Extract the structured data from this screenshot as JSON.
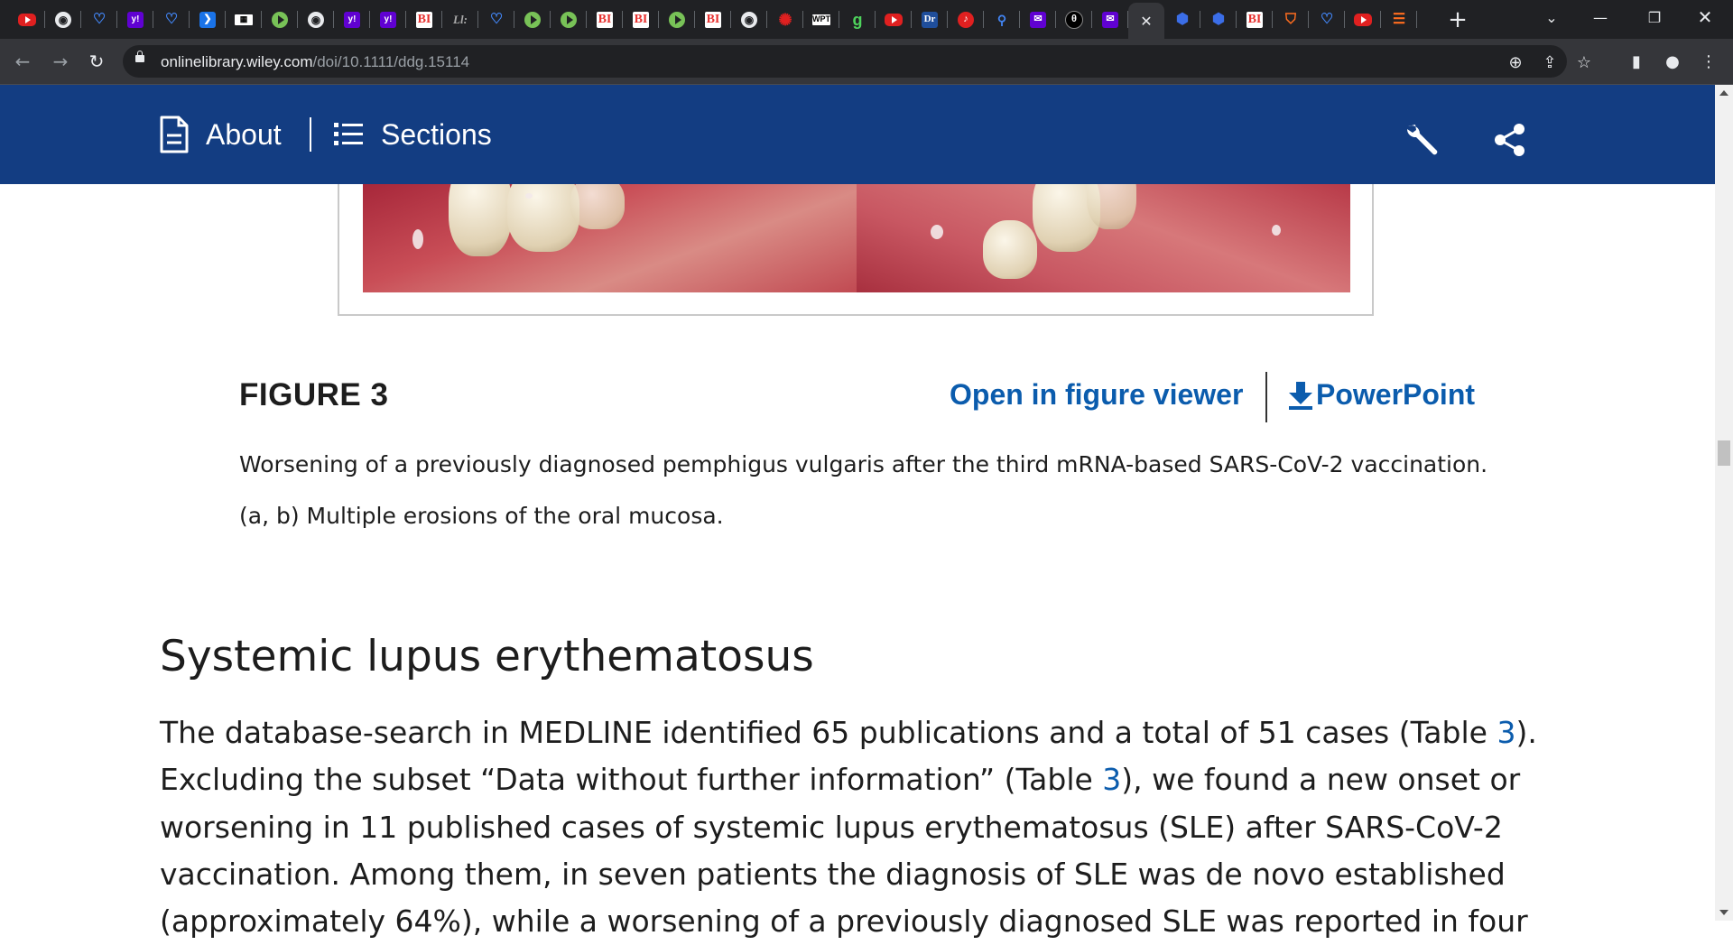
{
  "browser": {
    "tabs": [
      {
        "icon": "youtube-icon",
        "kind": "yt",
        "glyph": ""
      },
      {
        "icon": "globe-icon",
        "kind": "globe",
        "glyph": "◉"
      },
      {
        "icon": "shield-icon",
        "kind": "shield",
        "glyph": "♡"
      },
      {
        "icon": "yahoo-icon",
        "kind": "yahoo",
        "glyph": "y!"
      },
      {
        "icon": "shield-icon",
        "kind": "shield",
        "glyph": "♡"
      },
      {
        "icon": "arrow-tag-icon",
        "kind": "blue",
        "glyph": "❯"
      },
      {
        "icon": "qr-icon",
        "kind": "wpt",
        "glyph": "▦"
      },
      {
        "icon": "play-icon",
        "kind": "play",
        "glyph": ""
      },
      {
        "icon": "globe-icon",
        "kind": "globe",
        "glyph": "◉"
      },
      {
        "icon": "yahoo-icon",
        "kind": "yahoo",
        "glyph": "y!"
      },
      {
        "icon": "yahoo-icon",
        "kind": "yahoo",
        "glyph": "y!"
      },
      {
        "icon": "business-insider-icon",
        "kind": "bi",
        "glyph": "BI"
      },
      {
        "icon": "ii-icon",
        "kind": "ii",
        "glyph": "Ll:"
      },
      {
        "icon": "shield-icon",
        "kind": "shield",
        "glyph": "♡"
      },
      {
        "icon": "play-icon",
        "kind": "play",
        "glyph": ""
      },
      {
        "icon": "play-icon",
        "kind": "play",
        "glyph": ""
      },
      {
        "icon": "business-insider-icon",
        "kind": "bi",
        "glyph": "BI"
      },
      {
        "icon": "business-insider-icon",
        "kind": "bi",
        "glyph": "BI"
      },
      {
        "icon": "play-icon",
        "kind": "play",
        "glyph": ""
      },
      {
        "icon": "business-insider-icon",
        "kind": "bi",
        "glyph": "BI"
      },
      {
        "icon": "globe-icon",
        "kind": "globe",
        "glyph": "◉"
      },
      {
        "icon": "starburst-icon",
        "kind": "starb",
        "glyph": "✺"
      },
      {
        "icon": "wpt-icon",
        "kind": "wpt",
        "glyph": "WPT"
      },
      {
        "icon": "g-icon",
        "kind": "green",
        "glyph": "g"
      },
      {
        "icon": "youtube-icon",
        "kind": "yt",
        "glyph": ""
      },
      {
        "icon": "dr-icon",
        "kind": "dr",
        "glyph": "Dr"
      },
      {
        "icon": "podcast-icon",
        "kind": "red",
        "glyph": "♪"
      },
      {
        "icon": "search-icon",
        "kind": "mag",
        "glyph": "⚲"
      },
      {
        "icon": "mail-icon",
        "kind": "purple",
        "glyph": "✉"
      },
      {
        "icon": "theta-icon",
        "kind": "dark",
        "glyph": "θ"
      },
      {
        "icon": "mail-icon",
        "kind": "purple",
        "glyph": "✉"
      },
      {
        "icon": "close-icon",
        "kind": "active",
        "glyph": "✕"
      },
      {
        "icon": "hexagon-icon",
        "kind": "hex",
        "glyph": "⬢"
      },
      {
        "icon": "hexagon-icon",
        "kind": "hex",
        "glyph": "⬢"
      },
      {
        "icon": "business-insider-icon",
        "kind": "bi",
        "glyph": "BI"
      },
      {
        "icon": "brave-icon",
        "kind": "orange",
        "glyph": "⛉"
      },
      {
        "icon": "shield-icon",
        "kind": "shield",
        "glyph": "♡"
      },
      {
        "icon": "youtube-icon",
        "kind": "yt",
        "glyph": ""
      },
      {
        "icon": "rss-icon",
        "kind": "orange",
        "glyph": "☰"
      }
    ],
    "new_tab": "+",
    "url_host": "onlinelibrary.wiley.com",
    "url_path": "/doi/10.1111/ddg.15114"
  },
  "header": {
    "about_label": "About",
    "sections_label": "Sections"
  },
  "figure": {
    "label": "FIGURE 3",
    "open_viewer": "Open in figure viewer",
    "powerpoint": "PowerPoint",
    "caption_line1": "Worsening of a previously diagnosed pemphigus vulgaris after the third mRNA-based SARS-CoV-2 vaccination.",
    "caption_line2": "(a, b) Multiple erosions of the oral mucosa."
  },
  "section": {
    "title": "Systemic lupus erythematosus",
    "lines": [
      [
        "The database-search in MEDLINE identified 65 publications and a total of 51 cases (Table ",
        "3",
        ")."
      ],
      [
        "Excluding the subset “Data without further information” (Table ",
        "3",
        "), we found a new onset or"
      ],
      [
        "worsening in 11 published cases of systemic lupus erythematosus (SLE) after SARS-CoV-2",
        "",
        ""
      ],
      [
        "vaccination. Among them, in seven patients the diagnosis of SLE was de novo established",
        "",
        ""
      ],
      [
        "(approximately 64%), while a worsening of a previously diagnosed SLE was reported in four",
        "",
        ""
      ]
    ]
  }
}
